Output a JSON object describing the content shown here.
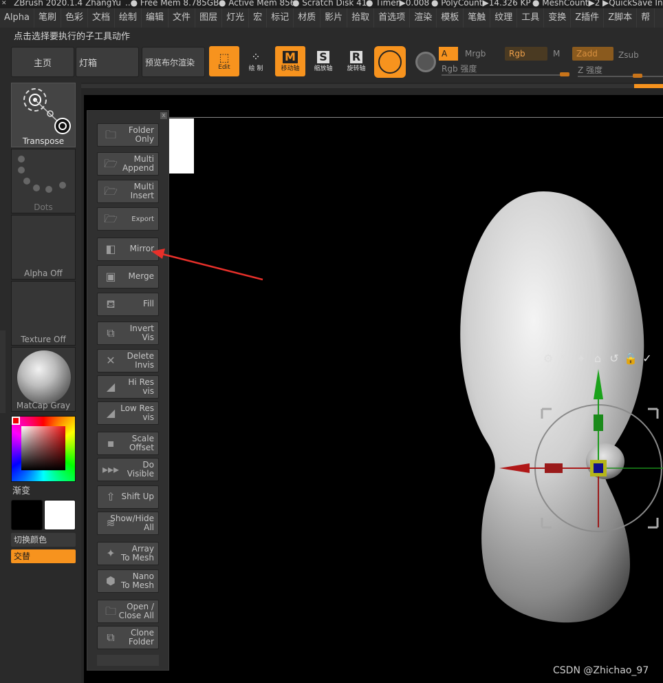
{
  "titlebar": {
    "logo_glyph": "✕",
    "items": [
      "ZBrush 2020.1.4",
      "ZhangYu",
      "..● Free Mem 8.785GB",
      "● Active Mem 856",
      "● Scratch Disk 41",
      "● Timer▶0.008",
      "● PolyCount▶14.326 KP",
      "● MeshCount▶2",
      "▶QuickSave In"
    ]
  },
  "menubar": [
    "Alpha",
    "笔刷",
    "色彩",
    "文档",
    "绘制",
    "编辑",
    "文件",
    "图层",
    "灯光",
    "宏",
    "标记",
    "材质",
    "影片",
    "拾取",
    "首选项",
    "渲染",
    "模板",
    "笔触",
    "纹理",
    "工具",
    "变换",
    "Z插件",
    "Z脚本",
    "帮"
  ],
  "hint": "点击选择要执行的子工具动作",
  "toolbar": {
    "home": "主页",
    "lightbox": "灯箱",
    "preview_bool": "预览布尔渲染",
    "edit": "Edit",
    "draw": "绘 制",
    "move": "移动轴",
    "scale": "缩放轴",
    "rotate": "旋转轴",
    "channels": {
      "a": "A",
      "mrgb": "Mrgb",
      "rgb": "Rgb",
      "m": "M",
      "zadd": "Zadd",
      "zsub": "Zsub",
      "rgb_intensity": "Rgb 强度",
      "z_intensity": "Z 强度"
    }
  },
  "sidebar": {
    "transpose": "Transpose",
    "dots": "Dots",
    "alpha_off": "Alpha Off",
    "texture_off": "Texture Off",
    "matcap": "MatCap Gray",
    "gradient": "渐变",
    "switch_color": "切换颜色",
    "alternate": "交替"
  },
  "panel": {
    "close": "x",
    "buttons": [
      {
        "label": "Folder\nOnly",
        "icon": "folder-icon",
        "glyph": "🗀",
        "key": "folder-only"
      },
      {
        "label": "Multi\nAppend",
        "icon": "multi-append-icon",
        "glyph": "🗁",
        "key": "multi-append"
      },
      {
        "label": "Multi\nInsert",
        "icon": "multi-insert-icon",
        "glyph": "🗁",
        "key": "multi-insert"
      },
      {
        "label": "Export",
        "icon": "export-icon",
        "glyph": "🗁",
        "key": "export"
      },
      {
        "label": "Mirror",
        "icon": "mirror-icon",
        "glyph": "◧",
        "key": "mirror"
      },
      {
        "label": "Merge",
        "icon": "merge-icon",
        "glyph": "▣",
        "key": "merge"
      },
      {
        "label": "Fill",
        "icon": "fill-icon",
        "glyph": "⛾",
        "key": "fill"
      },
      {
        "label": "Invert\nVis",
        "icon": "invert-vis-icon",
        "glyph": "⧉",
        "key": "invert-vis"
      },
      {
        "label": "Delete\nInvis",
        "icon": "delete-invis-icon",
        "glyph": "✕",
        "key": "delete-invis"
      },
      {
        "label": "Hi Res\nvis",
        "icon": "hi-res-icon",
        "glyph": "◢",
        "key": "hi-res-vis"
      },
      {
        "label": "Low Res\nvis",
        "icon": "low-res-icon",
        "glyph": "◢",
        "key": "low-res-vis"
      },
      {
        "label": "Scale\nOffset",
        "icon": "scale-offset-icon",
        "glyph": "▪",
        "key": "scale-offset"
      },
      {
        "label": "Do\nVisible",
        "icon": "do-visible-icon",
        "glyph": "▸▸▸",
        "key": "do-visible"
      },
      {
        "label": "Shift Up",
        "icon": "shift-up-icon",
        "glyph": "⇧",
        "key": "shift-up"
      },
      {
        "label": "Show/Hide\nAll",
        "icon": "show-hide-icon",
        "glyph": "≋",
        "key": "show-hide-all"
      },
      {
        "label": "Array\nTo Mesh",
        "icon": "array-icon",
        "glyph": "✦",
        "key": "array-to-mesh"
      },
      {
        "label": "Nano\nTo Mesh",
        "icon": "nano-icon",
        "glyph": "⬢",
        "key": "nano-to-mesh"
      },
      {
        "label": "Open /\nClose All",
        "icon": "open-close-icon",
        "glyph": "🗀",
        "key": "open-close-all"
      },
      {
        "label": "Clone\nFolder",
        "icon": "clone-folder-icon",
        "glyph": "⧉",
        "key": "clone-folder"
      }
    ]
  },
  "gizmo_tools": [
    {
      "glyph": "⚙",
      "icon": "gear-icon"
    },
    {
      "glyph": "✎",
      "icon": "pin-icon"
    },
    {
      "glyph": "⌖",
      "icon": "location-icon"
    },
    {
      "glyph": "⌂",
      "icon": "home-icon"
    },
    {
      "glyph": "↺",
      "icon": "reset-icon"
    },
    {
      "glyph": "🔒",
      "icon": "lock-icon"
    },
    {
      "glyph": "✓",
      "icon": "check-icon"
    }
  ],
  "watermark": "CSDN @Zhichao_97",
  "colors": {
    "accent": "#f7931e",
    "arrow": "#e8302a"
  }
}
